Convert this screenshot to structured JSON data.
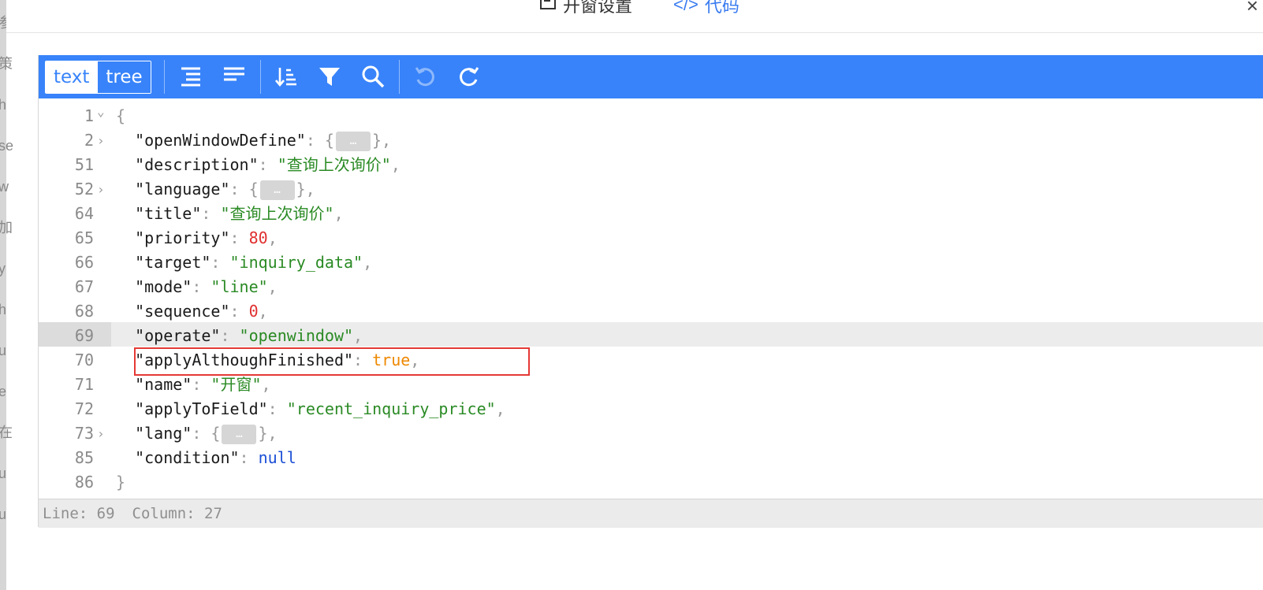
{
  "background": {
    "chars": [
      "参",
      "策",
      "h",
      "se",
      "w",
      "加",
      "y",
      "h",
      "u",
      "e",
      "在",
      "u",
      "u"
    ]
  },
  "dialog": {
    "tab_settings": "开窗设置",
    "tab_code": "代码",
    "tab_code_icon": "</>",
    "close": "×"
  },
  "toolbar": {
    "mode_text": "text",
    "mode_tree": "tree",
    "icons": [
      "format-icon",
      "compact-icon",
      "sort-icon",
      "filter-icon",
      "search-icon",
      "undo-icon",
      "redo-icon"
    ]
  },
  "colors": {
    "toolbar": "#3883fa",
    "key": "#1a1a1a",
    "string": "#2a8a24",
    "number": "#e03030",
    "boolean": "#ee8800",
    "null": "#1c4fd6",
    "highlight": "#e53935"
  },
  "lines": [
    {
      "n": "1",
      "fold": "v",
      "parts": [
        [
          "p",
          "{"
        ]
      ]
    },
    {
      "n": "2",
      "fold": ">",
      "parts": [
        [
          "k",
          "  \"openWindowDefine\""
        ],
        [
          "p",
          ": {"
        ],
        [
          "f",
          "…"
        ],
        [
          "p",
          "},"
        ]
      ]
    },
    {
      "n": "51",
      "fold": "",
      "parts": [
        [
          "k",
          "  \"description\""
        ],
        [
          "p",
          ": "
        ],
        [
          "s",
          "\"查询上次询价\""
        ],
        [
          "p",
          ","
        ]
      ]
    },
    {
      "n": "52",
      "fold": ">",
      "parts": [
        [
          "k",
          "  \"language\""
        ],
        [
          "p",
          ": {"
        ],
        [
          "f",
          "…"
        ],
        [
          "p",
          "},"
        ]
      ]
    },
    {
      "n": "64",
      "fold": "",
      "parts": [
        [
          "k",
          "  \"title\""
        ],
        [
          "p",
          ": "
        ],
        [
          "s",
          "\"查询上次询价\""
        ],
        [
          "p",
          ","
        ]
      ]
    },
    {
      "n": "65",
      "fold": "",
      "parts": [
        [
          "k",
          "  \"priority\""
        ],
        [
          "p",
          ": "
        ],
        [
          "n",
          "80"
        ],
        [
          "p",
          ","
        ]
      ]
    },
    {
      "n": "66",
      "fold": "",
      "parts": [
        [
          "k",
          "  \"target\""
        ],
        [
          "p",
          ": "
        ],
        [
          "s",
          "\"inquiry_data\""
        ],
        [
          "p",
          ","
        ]
      ]
    },
    {
      "n": "67",
      "fold": "",
      "parts": [
        [
          "k",
          "  \"mode\""
        ],
        [
          "p",
          ": "
        ],
        [
          "s",
          "\"line\""
        ],
        [
          "p",
          ","
        ]
      ]
    },
    {
      "n": "68",
      "fold": "",
      "parts": [
        [
          "k",
          "  \"sequence\""
        ],
        [
          "p",
          ": "
        ],
        [
          "n",
          "0"
        ],
        [
          "p",
          ","
        ]
      ]
    },
    {
      "n": "69",
      "fold": "",
      "parts": [
        [
          "k",
          "  \"operate\""
        ],
        [
          "p",
          ": "
        ],
        [
          "s",
          "\"openwindow\""
        ],
        [
          "p",
          ","
        ]
      ]
    },
    {
      "n": "70",
      "fold": "",
      "parts": [
        [
          "k",
          "  \"applyAlthoughFinished\""
        ],
        [
          "p",
          ": "
        ],
        [
          "b",
          "true"
        ],
        [
          "p",
          ","
        ]
      ]
    },
    {
      "n": "71",
      "fold": "",
      "parts": [
        [
          "k",
          "  \"name\""
        ],
        [
          "p",
          ": "
        ],
        [
          "s",
          "\"开窗\""
        ],
        [
          "p",
          ","
        ]
      ]
    },
    {
      "n": "72",
      "fold": "",
      "parts": [
        [
          "k",
          "  \"applyToField\""
        ],
        [
          "p",
          ": "
        ],
        [
          "s",
          "\"recent_inquiry_price\""
        ],
        [
          "p",
          ","
        ]
      ]
    },
    {
      "n": "73",
      "fold": ">",
      "parts": [
        [
          "k",
          "  \"lang\""
        ],
        [
          "p",
          ": {"
        ],
        [
          "f",
          "…"
        ],
        [
          "p",
          "},"
        ]
      ]
    },
    {
      "n": "85",
      "fold": "",
      "parts": [
        [
          "k",
          "  \"condition\""
        ],
        [
          "p",
          ": "
        ],
        [
          "nl",
          "null"
        ]
      ]
    },
    {
      "n": "86",
      "fold": "",
      "parts": [
        [
          "p",
          "}"
        ]
      ]
    }
  ],
  "status": {
    "line": "Line: 69",
    "column": "Column: 27"
  }
}
